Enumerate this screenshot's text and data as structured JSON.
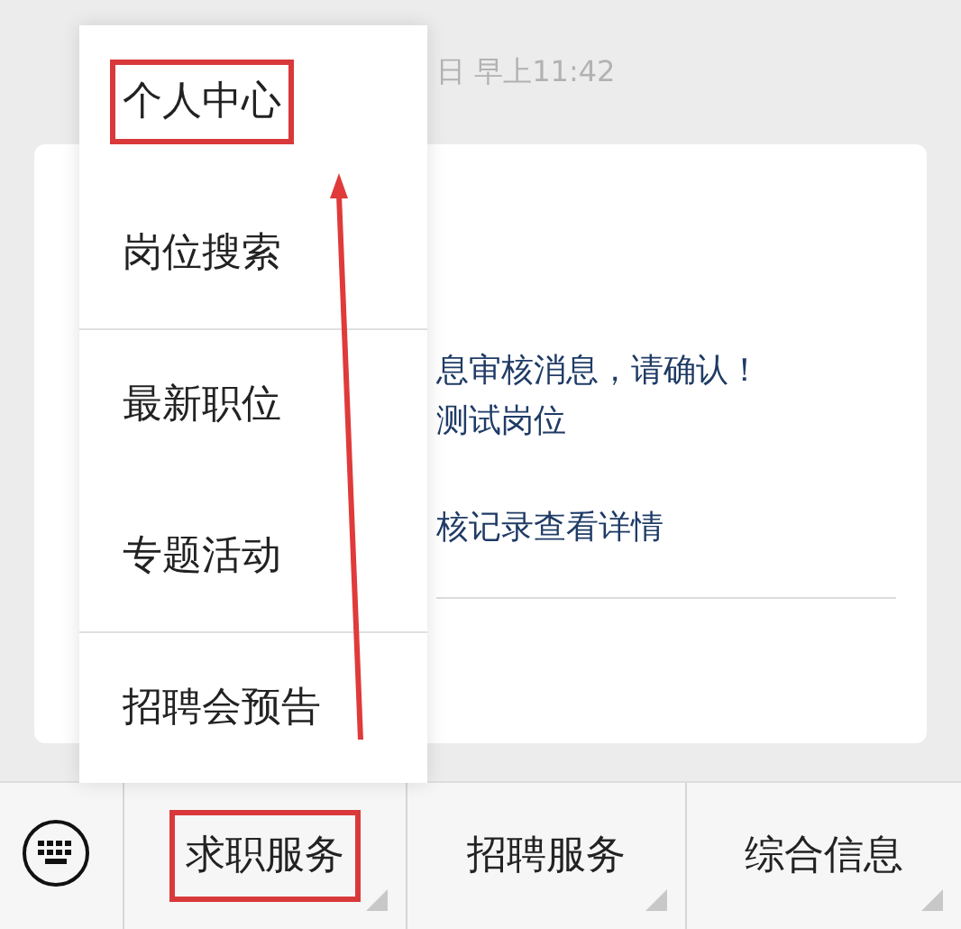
{
  "timestamp": "日 早上11:42",
  "message": {
    "lines": [
      "息审核消息，请确认！",
      "测试岗位",
      "核记录查看详情"
    ]
  },
  "menu": {
    "groups": [
      {
        "items": [
          {
            "label": "个人中心",
            "highlighted": true
          },
          {
            "label": "岗位搜索",
            "highlighted": false
          }
        ]
      },
      {
        "items": [
          {
            "label": "最新职位",
            "highlighted": false
          },
          {
            "label": "专题活动",
            "highlighted": false
          }
        ]
      },
      {
        "items": [
          {
            "label": "招聘会预告",
            "highlighted": false
          }
        ]
      }
    ]
  },
  "annotation_arrow": true,
  "bottom_menu": [
    {
      "label": "求职服务",
      "highlighted": true
    },
    {
      "label": "招聘服务",
      "highlighted": false
    },
    {
      "label": "综合信息",
      "highlighted": false
    }
  ]
}
